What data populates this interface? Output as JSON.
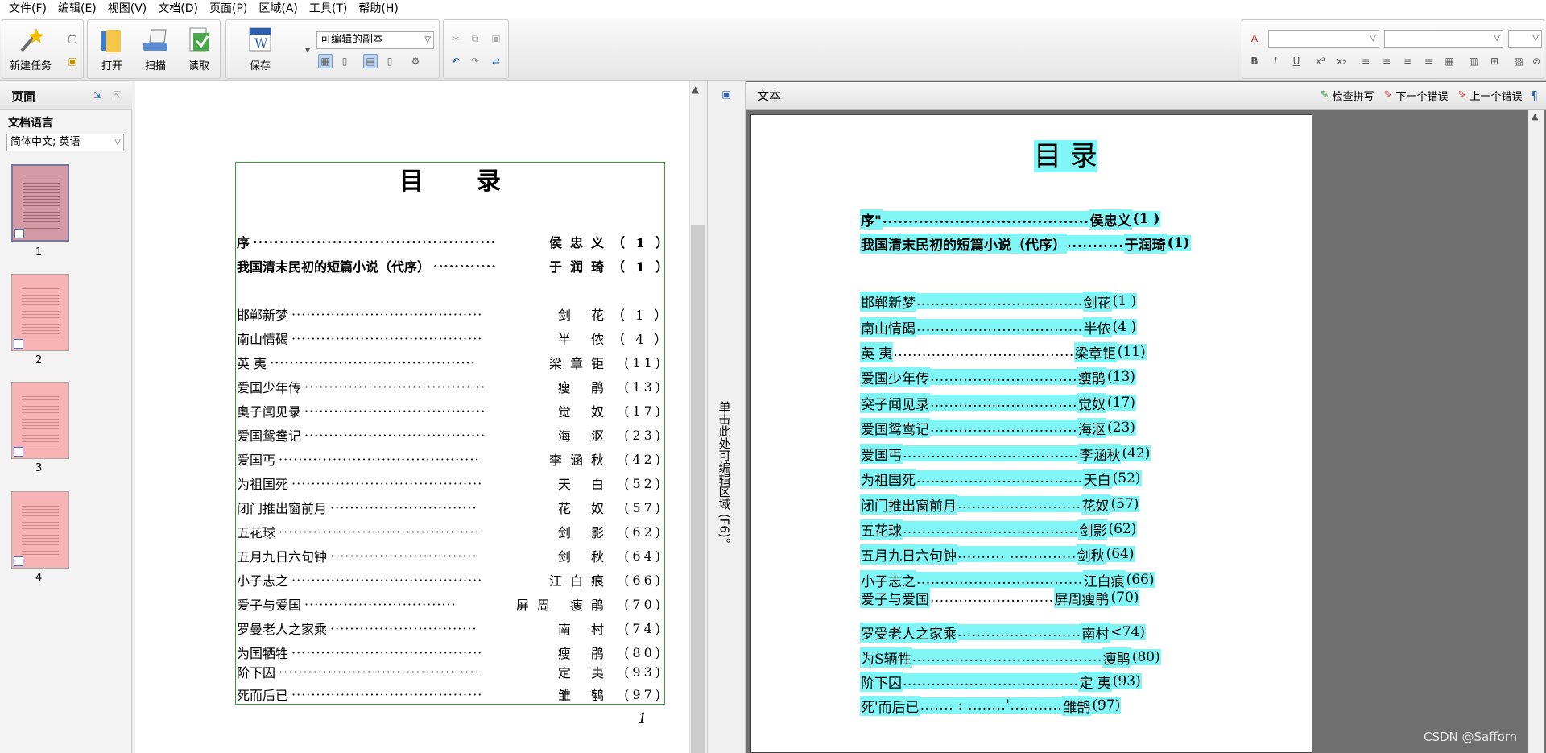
{
  "menu": [
    "文件(F)",
    "编辑(E)",
    "视图(V)",
    "文档(D)",
    "页面(P)",
    "区域(A)",
    "工具(T)",
    "帮助(H)"
  ],
  "toolbar": {
    "new_task": "新建任务",
    "open": "打开",
    "scan": "扫描",
    "read": "读取",
    "save": "保存",
    "save_format": "可编辑的副本"
  },
  "left_panel": {
    "title": "页面",
    "doc_language_label": "文档语言",
    "doc_language_value": "简体中文; 英语",
    "pages": [
      "1",
      "2",
      "3",
      "4"
    ]
  },
  "image_page": {
    "title_chars": [
      "目",
      "录"
    ],
    "entries": [
      {
        "title": "序",
        "dots": "··············································",
        "author": "侯忠义",
        "page": "（ 1 ）"
      },
      {
        "title": "我国清末民初的短篇小说（代序）",
        "dots": "············",
        "author": "于润琦",
        "page": "（ 1 ）"
      },
      {
        "title": "邯郸新梦",
        "dots": "·······································",
        "author": "剑 花",
        "page": "（ 1 ）"
      },
      {
        "title": "南山情碣",
        "dots": "·······································",
        "author": "半 侬",
        "page": "（ 4 ）"
      },
      {
        "title": "英 夷",
        "dots": "··········································",
        "author": "梁章钜",
        "page": "(11)"
      },
      {
        "title": "爱国少年传",
        "dots": "·····································",
        "author": "瘦 鹃",
        "page": "(13)"
      },
      {
        "title": "奥子闻见录",
        "dots": "·····································",
        "author": "觉 奴",
        "page": "(17)"
      },
      {
        "title": "爱国鸳鸯记",
        "dots": "·····································",
        "author": "海 沤",
        "page": "(23)"
      },
      {
        "title": "爱国丐",
        "dots": "·········································",
        "author": "李涵秋",
        "page": "(42)"
      },
      {
        "title": "为祖国死",
        "dots": "·······································",
        "author": "天 白",
        "page": "(52)"
      },
      {
        "title": "闭门推出窗前月",
        "dots": "······························",
        "author": "花 奴",
        "page": "(57)"
      },
      {
        "title": "五花球",
        "dots": "·········································",
        "author": "剑 影",
        "page": "(62)"
      },
      {
        "title": "五月九日六句钟",
        "dots": "······························",
        "author": "剑 秋",
        "page": "(64)"
      },
      {
        "title": "小子志之",
        "dots": "·······································",
        "author": "江白痕",
        "page": "(66)"
      },
      {
        "title": "爱子与爱国",
        "dots": "·······························",
        "author": "屏周 瘦鹃",
        "page": "(70)"
      },
      {
        "title": "罗曼老人之家乘",
        "dots": "······························",
        "author": "南 村",
        "page": "(74)"
      },
      {
        "title": "为国牺牲",
        "dots": "·······································",
        "author": "瘦 鹃",
        "page": "(80)"
      },
      {
        "title": "阶下囚",
        "dots": "·········································",
        "author": "定 夷",
        "page": "(93)"
      },
      {
        "title": "死而后已",
        "dots": "·······································",
        "author": "雏 鹤",
        "page": "(97)"
      }
    ],
    "page_number": "1"
  },
  "splitter_text": "单击此处可编辑区域 (F6)。",
  "text_pane": {
    "title": "文本",
    "spellcheck": "检查拼写",
    "next_error": "下一个错误",
    "prev_error": "上一个错误",
    "doc_title": "目 录",
    "entries": [
      {
        "title": "序\"",
        "dots": "........................................",
        "author": "侯忠义",
        "page": "(1 )"
      },
      {
        "title": "我国清末民初的短篇小说（代序）",
        "dots": "...........",
        "author": "于润琦",
        "page": "(1)"
      },
      {
        "title": "邯郸新梦",
        "dots": "...................................",
        "author": "剑花",
        "page": "(1 )"
      },
      {
        "title": "南山情碣",
        "dots": "...................................",
        "author": "半侬",
        "page": "(4 )"
      },
      {
        "title": "英 夷",
        "dots": "......................................",
        "author": "梁章钜",
        "page": "(11)"
      },
      {
        "title": "爱国少年传",
        "dots": "...............................",
        "author": "瘦鹃",
        "page": "(13)"
      },
      {
        "title": "突子闻见录",
        "dots": "...............................",
        "author": "觉奴",
        "page": "(17)"
      },
      {
        "title": "爱国鸳鸯记",
        "dots": "...............................",
        "author": "海沤",
        "page": "(23)"
      },
      {
        "title": "爱国丐",
        "dots": ".....................................",
        "author": "李涵秋",
        "page": "(42)"
      },
      {
        "title": "为祖国死",
        "dots": "...................................",
        "author": "天白",
        "page": "(52)"
      },
      {
        "title": "闭门推出窗前月",
        "dots": "..........................",
        "author": "花奴",
        "page": "(57)"
      },
      {
        "title": "五花球",
        "dots": ".....................................",
        "author": "剑影",
        "page": "(62)"
      },
      {
        "title": "五月九日六句钟",
        "dots": "..........  ..............",
        "author": "剑秋",
        "page": "(64)"
      },
      {
        "title": "小子志之",
        "dots": "...................................",
        "author": "江白痕",
        "page": "(66)"
      },
      {
        "title": "爱子与爱国",
        "dots": "..........................",
        "author": "屏周瘦鹃",
        "page": "(70)"
      },
      {
        "title": "罗受老人之家乘",
        "dots": "..........................",
        "author": "南村",
        "page": "<74)"
      },
      {
        "title": "为S辆牲",
        "dots": "........................................",
        "author": "瘦鹃",
        "page": "(80)"
      },
      {
        "title": "阶下囚",
        "dots": ".....................................",
        "author": "定 夷",
        "page": "(93)"
      },
      {
        "title": "死'而后已",
        "dots": "....... : ........'...........",
        "author": "雏鹄",
        "page": "(97)"
      }
    ]
  },
  "watermark": "CSDN @Safforn"
}
